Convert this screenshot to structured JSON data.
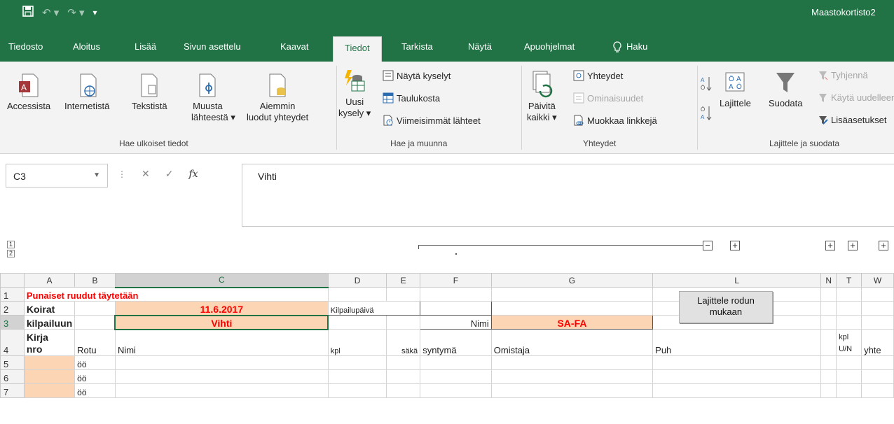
{
  "app": {
    "title": "Maastokortisto2"
  },
  "tabs": [
    "Tiedosto",
    "Aloitus",
    "Lisää",
    "Sivun asettelu",
    "Kaavat",
    "Tiedot",
    "Tarkista",
    "Näytä",
    "Apuohjelmat",
    "Haku"
  ],
  "active_tab": "Tiedot",
  "ribbon": {
    "get_external": {
      "label": "Hae ulkoiset tiedot",
      "buttons": [
        "Accessista",
        "Internetistä",
        "Tekstistä",
        "Muusta",
        "lähteestä ▾",
        "Aiemmin",
        "luodut yhteydet"
      ]
    },
    "get_transform": {
      "label": "Hae ja muunna",
      "new_query": [
        "Uusi",
        "kysely ▾"
      ],
      "items": [
        "Näytä kyselyt",
        "Taulukosta",
        "Viimeisimmät lähteet"
      ]
    },
    "connections": {
      "label": "Yhteydet",
      "refresh": [
        "Päivitä",
        "kaikki ▾"
      ],
      "items": [
        "Yhteydet",
        "Ominaisuudet",
        "Muokkaa linkkejä"
      ]
    },
    "sort_filter": {
      "label": "Lajittele ja suodata",
      "sort": "Lajittele",
      "filter": "Suodata",
      "items": [
        "Tyhjennä",
        "Käytä uudelleen",
        "Lisäasetukset"
      ]
    }
  },
  "formula_bar": {
    "name_box": "C3",
    "value": "Vihti"
  },
  "columns": [
    "A",
    "B",
    "C",
    "D",
    "E",
    "F",
    "G",
    "L",
    "N",
    "T",
    "W"
  ],
  "rows": {
    "r1": "Punaiset ruudut täytetään",
    "r2": {
      "a": "Koirat",
      "c": "11.6.2017",
      "d": "Kilpailupäivä"
    },
    "r3": {
      "a": "kilpailuun",
      "c": "Vihti",
      "f": "Nimi",
      "g": "SA-FA"
    },
    "r4": {
      "a": "Kirja",
      "a2": "nro",
      "b": "Rotu",
      "c": "Nimi",
      "d": "kpl",
      "e": "säkä",
      "f": "syntymä",
      "g": "Omistaja",
      "l": "Puh",
      "t": "kpl",
      "t2": "U/N",
      "w": "yhte"
    },
    "data_rows": [
      {
        "num": "5",
        "b": "öö"
      },
      {
        "num": "6",
        "b": "öö"
      },
      {
        "num": "7",
        "b": "öö"
      }
    ]
  },
  "sort_button": [
    "Lajittele rodun",
    "mukaan"
  ],
  "outline_levels": [
    "1",
    "2"
  ]
}
